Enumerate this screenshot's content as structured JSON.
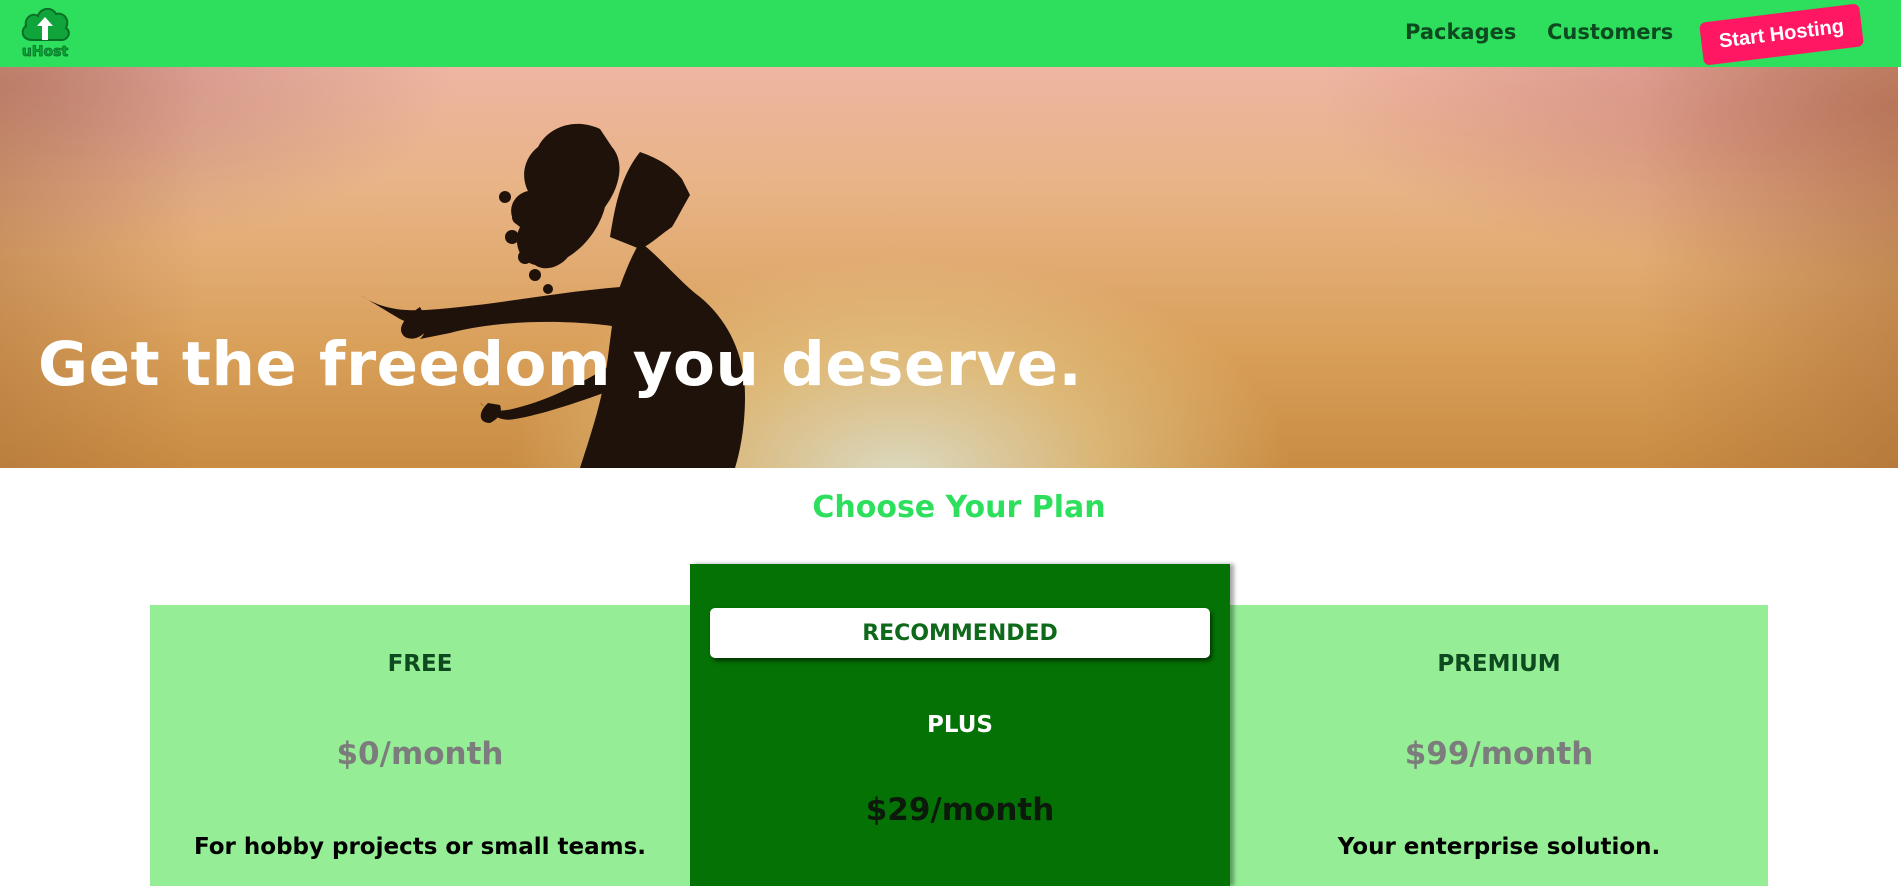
{
  "header": {
    "logo_text": "uHost",
    "nav": {
      "packages": "Packages",
      "customers": "Customers"
    },
    "cta_label": "Start Hosting"
  },
  "hero": {
    "title": "Get the freedom you deserve."
  },
  "plans": {
    "heading": "Choose Your Plan",
    "items": [
      {
        "name": "FREE",
        "price": "$0/month",
        "description": "For hobby projects or small teams."
      },
      {
        "badge": "RECOMMENDED",
        "name": "PLUS",
        "price": "$29/month"
      },
      {
        "name": "PREMIUM",
        "price": "$99/month",
        "description": "Your enterprise solution."
      }
    ]
  },
  "colors": {
    "header_bg": "#2ddf5c",
    "cta_bg": "#ff1764",
    "plan_light_bg": "#95ee95",
    "plan_recommended_bg": "#057205",
    "heading_green": "#2ddf5c"
  }
}
